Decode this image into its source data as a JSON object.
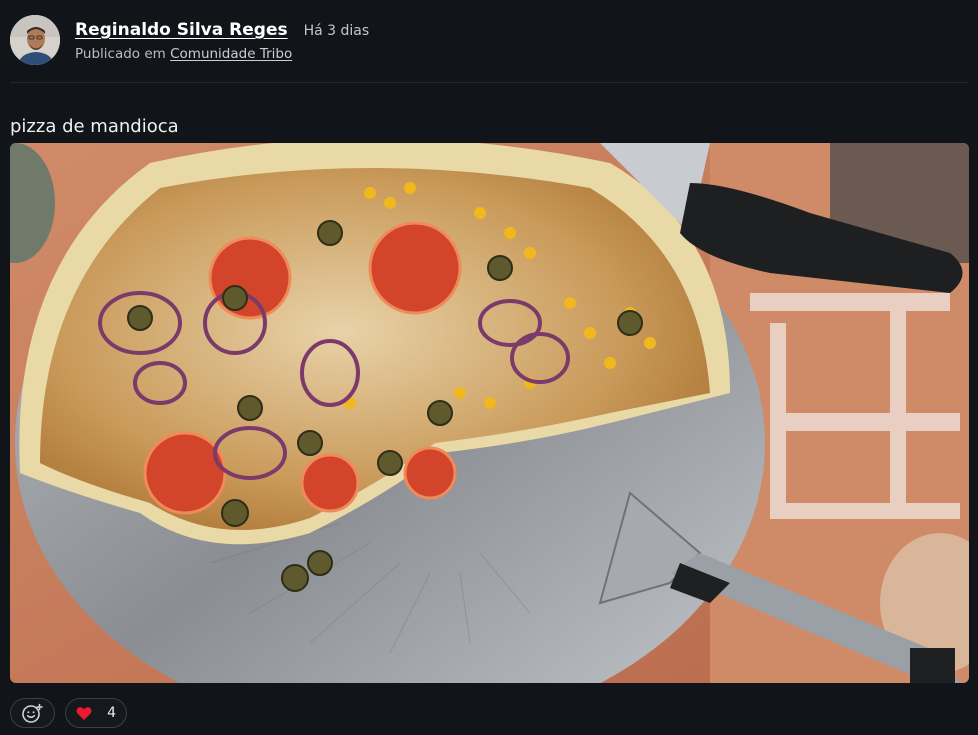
{
  "post": {
    "author_name": "Reginaldo Silva Reges",
    "time_ago": "Há 3 dias",
    "published_prefix": "Publicado em",
    "community_name": "Comunidade Tribo",
    "text": "pizza de mandioca",
    "image_description": "photo of a cassava pizza on an aluminum tray with a knife and spatula"
  },
  "actions": {
    "reaction_icon": "add-reaction-icon",
    "like_icon": "heart-icon",
    "like_count": "4"
  },
  "colors": {
    "background": "#111418",
    "like_red": "#ef1a2e"
  }
}
